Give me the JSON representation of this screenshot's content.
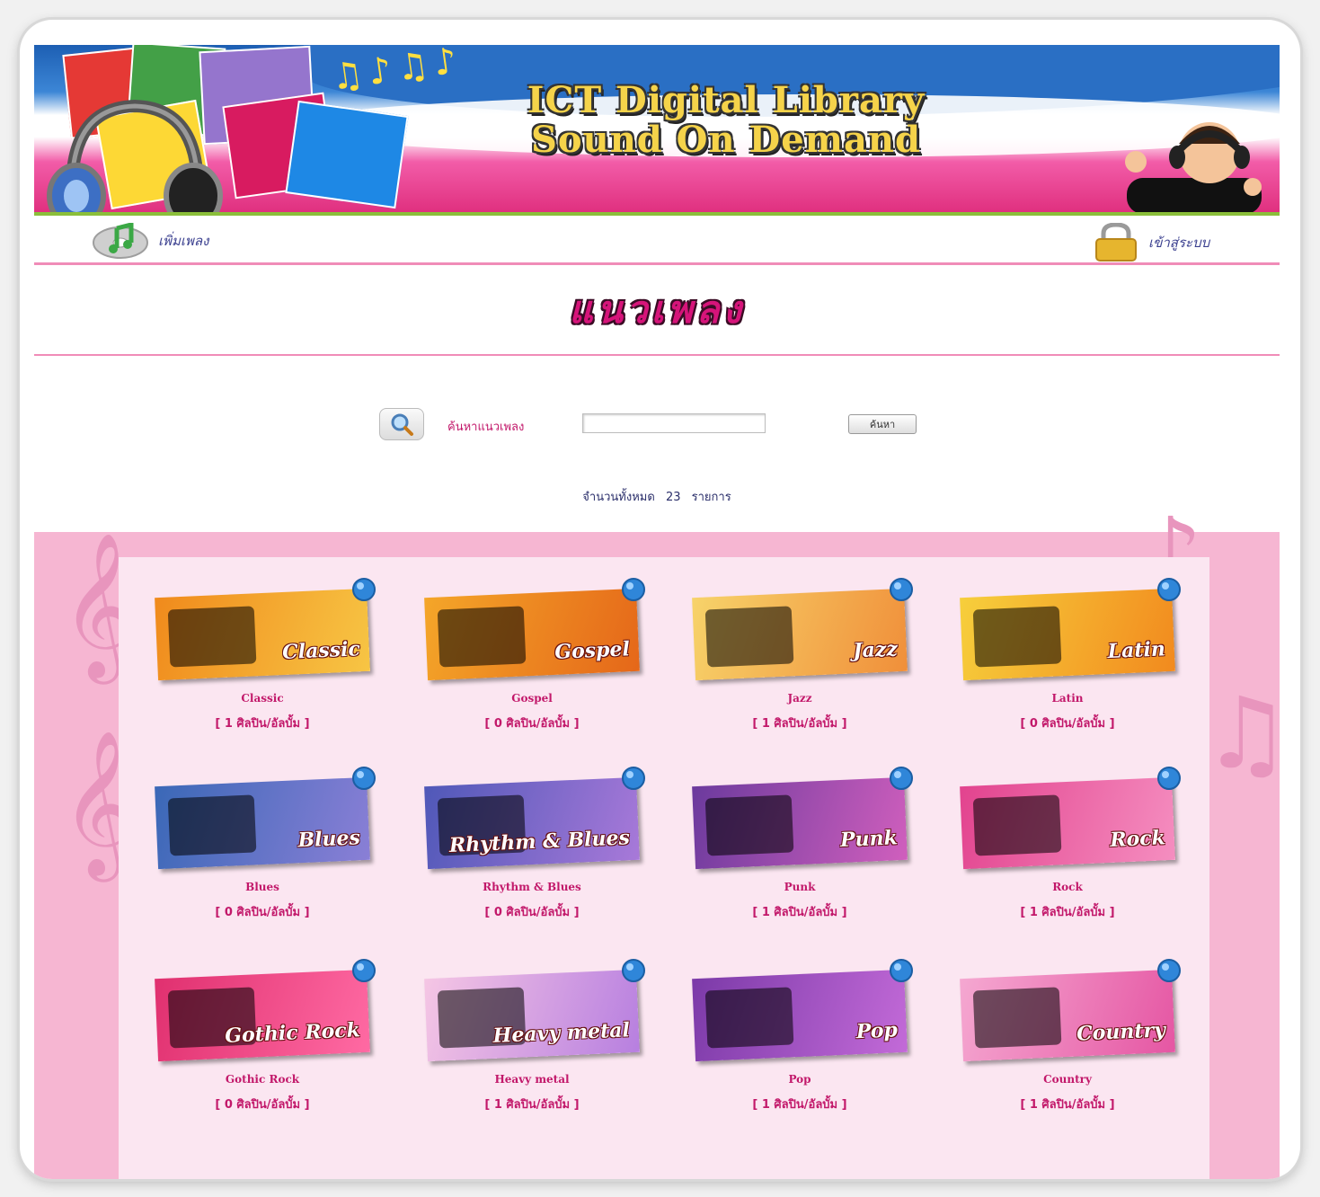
{
  "banner": {
    "title_line1": "ICT Digital Library",
    "title_line2": "Sound On Demand"
  },
  "nav": {
    "add_song_label": "เพิ่มเพลง",
    "login_label": "เข้าสู่ระบบ"
  },
  "page_title": "แนวเพลง",
  "search": {
    "label": "ค้นหาแนวเพลง",
    "value": "",
    "button_label": "ค้นหา"
  },
  "count": {
    "prefix": "จำนวนทั้งหมด",
    "value": "23",
    "suffix": "รายการ"
  },
  "colors": {
    "accent_pink": "#c2186a",
    "title_pink": "#d6147a",
    "panel_bg": "#fbe6f1",
    "outer_bg": "#f6b6d2",
    "nav_text": "#3a3f8f"
  },
  "genres": [
    {
      "name": "Classic",
      "image_text": "Classic",
      "count": "[ 1  ศิลปิน/อัลบั้ม ]",
      "colors": [
        "#f08a1c",
        "#f7c544"
      ],
      "icon": "violin-icon"
    },
    {
      "name": "Gospel",
      "image_text": "Gospel",
      "count": "[ 0  ศิลปิน/อัลบั้ม ]",
      "colors": [
        "#f4a629",
        "#e56719"
      ],
      "icon": "cd-icon"
    },
    {
      "name": "Jazz",
      "image_text": "Jazz",
      "count": "[ 1  ศิลปิน/อัลบั้ม ]",
      "colors": [
        "#f7d36a",
        "#f08f3a"
      ],
      "icon": "saxophone-icon"
    },
    {
      "name": "Latin",
      "image_text": "Latin",
      "count": "[ 0  ศิลปิน/อัลบั้ม ]",
      "colors": [
        "#f6cf3c",
        "#f28a1e"
      ],
      "icon": "dancer-icon"
    },
    {
      "name": "Blues",
      "image_text": "Blues",
      "count": "[ 0  ศิลปิน/อัลบั้ม ]",
      "colors": [
        "#3a68b7",
        "#8a7fd6"
      ],
      "icon": "note-icon"
    },
    {
      "name": "Rhythm & Blues",
      "image_text": "Rhythm & Blues",
      "count": "[ 0  ศิลปิน/อัลบั้ม ]",
      "colors": [
        "#4f58b8",
        "#a879d9"
      ],
      "icon": "globe-icon"
    },
    {
      "name": "Punk",
      "image_text": "Punk",
      "count": "[ 1  ศิลปิน/อัลบั้ม ]",
      "colors": [
        "#6b3a9d",
        "#d05fbd"
      ],
      "icon": "guitar-icon"
    },
    {
      "name": "Rock",
      "image_text": "Rock",
      "count": "[ 1  ศิลปิน/อัลบั้ม ]",
      "colors": [
        "#e2438e",
        "#f58ec0"
      ],
      "icon": "wings-icon"
    },
    {
      "name": "Gothic Rock",
      "image_text": "Gothic Rock",
      "count": "[ 0  ศิลปิน/อัลบั้ม ]",
      "colors": [
        "#e0306f",
        "#ff6aa3"
      ],
      "icon": "portrait-icon"
    },
    {
      "name": "Heavy metal",
      "image_text": "Heavy metal",
      "count": "[ 1  ศิลปิน/อัลบั้ม ]",
      "colors": [
        "#f5c6e4",
        "#b77fe0"
      ],
      "icon": "crowd-icon"
    },
    {
      "name": "Pop",
      "image_text": "Pop",
      "count": "[ 1  ศิลปิน/อัลบั้ม ]",
      "colors": [
        "#7b3aa8",
        "#c36ad8"
      ],
      "icon": "skull-icon"
    },
    {
      "name": "Country",
      "image_text": "Country",
      "count": "[ 1  ศิลปิน/อัลบั้ม ]",
      "colors": [
        "#f5a8d1",
        "#e556a3"
      ],
      "icon": "acoustic-guitar-icon"
    }
  ]
}
